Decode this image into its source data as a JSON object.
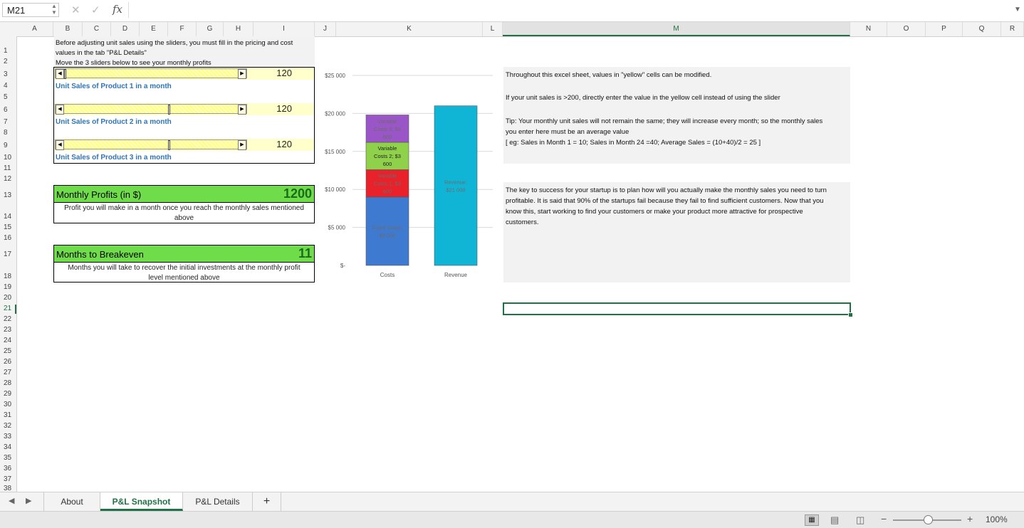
{
  "formula_bar": {
    "name_box": "M21",
    "fx_label": "fx",
    "formula": ""
  },
  "columns": [
    "A",
    "B",
    "C",
    "D",
    "E",
    "F",
    "G",
    "H",
    "I",
    "J",
    "K",
    "L",
    "M",
    "N",
    "O",
    "P",
    "Q",
    "R"
  ],
  "rows": [
    "1",
    "2",
    "3",
    "4",
    "5",
    "6",
    "7",
    "8",
    "9",
    "10",
    "11",
    "12",
    "13",
    "14",
    "15",
    "16",
    "17",
    "18",
    "19",
    "20",
    "21",
    "22",
    "23",
    "24",
    "25",
    "26",
    "27",
    "28",
    "29",
    "30",
    "31",
    "32",
    "33",
    "34",
    "35",
    "36",
    "37",
    "38"
  ],
  "selected_cell": {
    "column": "M",
    "row": "21"
  },
  "intro": {
    "line1": "Before adjusting unit sales using the sliders, you must fill in the pricing and cost",
    "line2": "values in the tab \"P&L Details\"",
    "line3": "Move the 3 sliders below to see your monthly profits"
  },
  "sliders": [
    {
      "value": "120",
      "label": "Unit Sales of Product 1 in a month",
      "position": 0.0
    },
    {
      "value": "120",
      "label": "Unit Sales of Product 2 in a month",
      "position": 0.6
    },
    {
      "value": "120",
      "label": "Unit Sales of Product 3 in a month",
      "position": 0.6
    }
  ],
  "profits": {
    "title": "Monthly Profits (in $)",
    "value": "1200",
    "sub1": "Profit you will make in a month once you reach the monthly sales mentioned",
    "sub2": "above"
  },
  "breakeven": {
    "title": "Months to Breakeven",
    "value": "11",
    "sub1": "Months you will take to recover the initial investments at the monthly profit",
    "sub2": "level mentioned above"
  },
  "chart_data": {
    "type": "bar",
    "stacked": true,
    "categories": [
      "Costs",
      "Revenue"
    ],
    "y_ticks": [
      "$-",
      "$5 000",
      "$10 000",
      "$15 000",
      "$20 000",
      "$25 000"
    ],
    "ylim": [
      0,
      25000
    ],
    "grid": true,
    "series": [
      {
        "label": "Fixed Costs; $9 000",
        "category": "Costs",
        "value": 9000,
        "color": "#3f7ad1"
      },
      {
        "label": "Variable Costs 1; $3 600",
        "category": "Costs",
        "value": 3600,
        "color": "#e8212b"
      },
      {
        "label": "Variable Costs 2; $3 600",
        "category": "Costs",
        "value": 3600,
        "color": "#8fd14a"
      },
      {
        "label": "Variable Costs 3; $3 600",
        "category": "Costs",
        "value": 3600,
        "color": "#9a56c7"
      },
      {
        "label": "Revenue; $21 000",
        "category": "Revenue",
        "value": 21000,
        "color": "#10b5d6"
      }
    ]
  },
  "note1": {
    "p1": "Throughout this excel sheet, values in \"yellow\" cells can be modified.",
    "p2": "If your unit sales is >200, directly enter the value in the yellow cell instead of using the slider",
    "p3a": "Tip: Your monthly unit sales will not remain the same; they will increase every month; so the monthly sales",
    "p3b": "you enter here must be an average value",
    "p3c": "[ eg: Sales in Month 1 = 10; Sales in Month 24 =40; Average Sales = (10+40)/2 = 25 ]"
  },
  "note2": {
    "l1": "The key to success for your startup is to plan how will you actually make the monthly sales you need to turn",
    "l2": "profitable. It is said that 90% of the startups fail because they fail to find sufficient customers. Now that you",
    "l3": "know this, start working to find your customers or make your product more attractive for prospective",
    "l4": "customers."
  },
  "tabs": [
    "About",
    "P&L Snapshot",
    "P&L Details"
  ],
  "active_tab": "P&L Snapshot",
  "add_sheet": "+",
  "zoom": "100%",
  "zoom_minus": "−",
  "zoom_plus": "+"
}
